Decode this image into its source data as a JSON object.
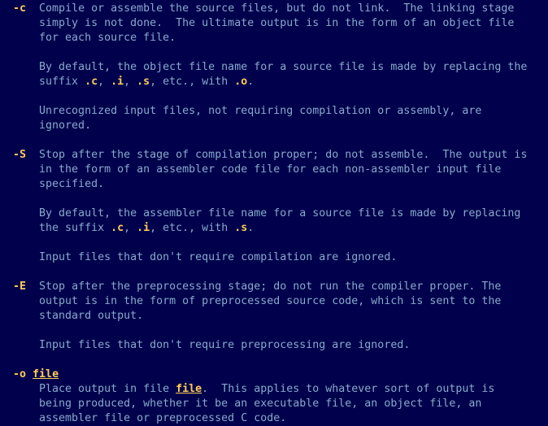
{
  "options": [
    {
      "flag": "-c",
      "arg": null,
      "paras": [
        [
          {
            "t": "Compile or assemble the source files, but do not link.  The linking stage simply is not done.  The ultimate output is in the form of an object file for each source file."
          }
        ],
        [
          {
            "t": "By default, the object file name for a source file is made by replacing the suffix "
          },
          {
            "t": ".c",
            "cls": "hl-b"
          },
          {
            "t": ", "
          },
          {
            "t": ".i",
            "cls": "hl-b"
          },
          {
            "t": ", "
          },
          {
            "t": ".s",
            "cls": "hl-b"
          },
          {
            "t": ", etc., with "
          },
          {
            "t": ".o",
            "cls": "hl-b"
          },
          {
            "t": "."
          }
        ],
        [
          {
            "t": "Unrecognized input files, not requiring compilation or assembly, are ignored."
          }
        ]
      ]
    },
    {
      "flag": "-S",
      "arg": null,
      "paras": [
        [
          {
            "t": "Stop after the stage of compilation proper; do not assemble.  The output is in the form of an assembler code file for each non-assembler input file specified."
          }
        ],
        [
          {
            "t": "By default, the assembler file name for a source file is made by replacing the suffix "
          },
          {
            "t": ".c",
            "cls": "hl-b"
          },
          {
            "t": ", "
          },
          {
            "t": ".i",
            "cls": "hl-b"
          },
          {
            "t": ", etc., with "
          },
          {
            "t": ".s",
            "cls": "hl-b"
          },
          {
            "t": "."
          }
        ],
        [
          {
            "t": "Input files that don't require compilation are ignored."
          }
        ]
      ]
    },
    {
      "flag": "-E",
      "arg": null,
      "paras": [
        [
          {
            "t": "Stop after the preprocessing stage; do not run the compiler proper. The output is in the form of preprocessed source code, which is sent to the standard output."
          }
        ],
        [
          {
            "t": "Input files that don't require preprocessing are ignored."
          }
        ]
      ]
    },
    {
      "flag": "-o",
      "arg": "file",
      "paras": [
        [
          {
            "t": "Place output in file "
          },
          {
            "t": "file",
            "cls": "hl-u"
          },
          {
            "t": ".  This applies to whatever sort of output is being produced, whether it be an executable file, an object file, an assembler file or preprocessed C code."
          }
        ]
      ]
    }
  ]
}
